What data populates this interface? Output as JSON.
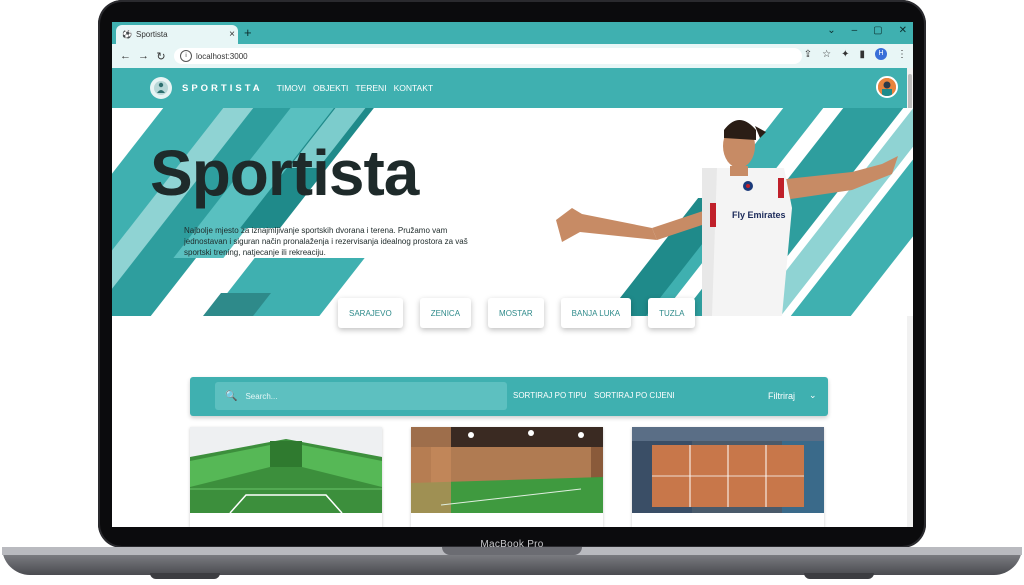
{
  "device": {
    "label": "MacBook Pro"
  },
  "browser": {
    "tab_title": "Sportista",
    "url": "localhost:3000",
    "profile_initial": "H"
  },
  "navbar": {
    "brand": "SPORTISTA",
    "links": [
      "TIMOVI",
      "OBJEKTI",
      "TERENI",
      "KONTAKT"
    ]
  },
  "hero": {
    "title": "Sportista",
    "description": "Najbolje mjesto za iznajmljivanje sportskih dvorana i terena. Pružamo vam jednostavan i siguran način pronalaženja i rezervisanja idealnog prostora za vaš sportski trening, natjecanje ili rekreaciju.",
    "jersey_text": "Fly Emirates"
  },
  "cities": [
    "SARAJEVO",
    "ZENICA",
    "MOSTAR",
    "BANJA LUKA",
    "TUZLA"
  ],
  "filter": {
    "search_placeholder": "Search...",
    "sort_type": "SORTIRAJ PO TIPU",
    "sort_price": "SORTIRAJ PO CIJENI",
    "filter_label": "Filtriraj"
  },
  "colors": {
    "primary": "#3fb0b0",
    "primary_dark": "#2e8a8a",
    "hero_text": "#1e2a2a"
  },
  "icons": [
    "search-icon",
    "chevron-down-icon",
    "back-icon",
    "forward-icon",
    "reload-icon",
    "star-icon",
    "extensions-icon",
    "close-icon",
    "plus-icon"
  ]
}
